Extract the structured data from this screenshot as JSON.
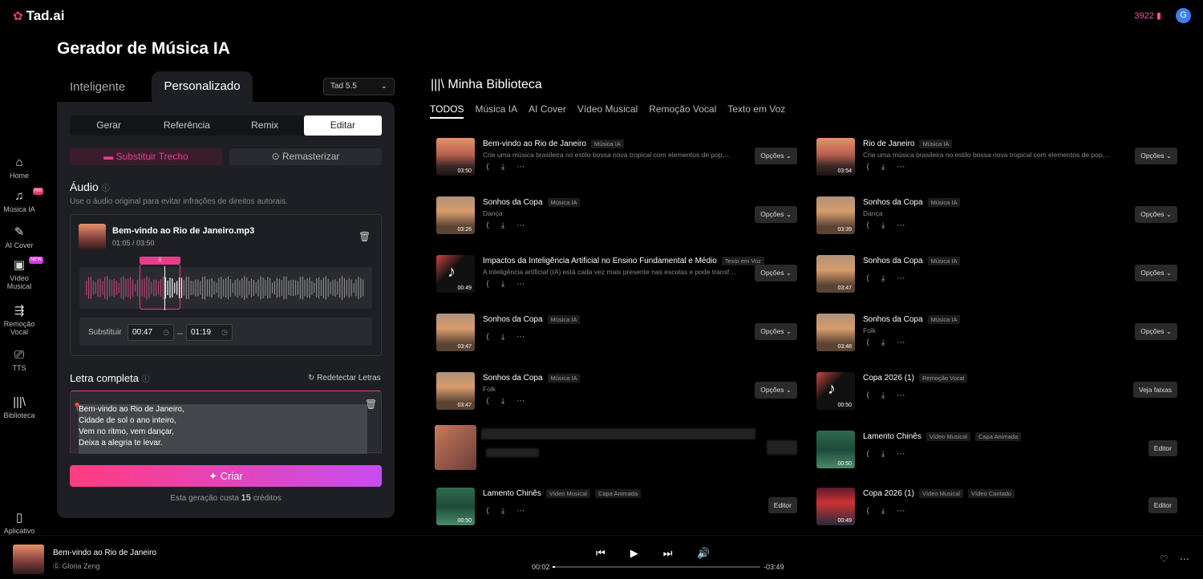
{
  "app": {
    "logo": "Tad.ai",
    "credits": "3922",
    "avatar": "G"
  },
  "sidebar": [
    {
      "label": "Home",
      "icon": "home-icon",
      "glyph": "⌂"
    },
    {
      "label": "Música IA",
      "icon": "music-icon",
      "glyph": "♫",
      "badge": "Hot"
    },
    {
      "label": "AI Cover",
      "icon": "mic-icon",
      "glyph": "✎"
    },
    {
      "label": "Vídeo Musical",
      "icon": "video-icon",
      "glyph": "▣",
      "badge": "NEW"
    },
    {
      "label": "Remoção Vocal",
      "icon": "split-icon",
      "glyph": "⇶"
    },
    {
      "label": "TTS",
      "icon": "tts-icon",
      "glyph": "⎚"
    },
    {
      "label": "Biblioteca",
      "icon": "library-icon",
      "glyph": "|||\\"
    },
    {
      "label": "Aplicativo",
      "icon": "phone-icon",
      "glyph": "▯"
    }
  ],
  "page_title": "Gerador de Música IA",
  "tabs": {
    "inteligente": "Inteligente",
    "personalizado": "Personalizado"
  },
  "model": "Tad 5.5",
  "subtabs": [
    "Gerar",
    "Referência",
    "Remix",
    "Editar"
  ],
  "modes": {
    "substituir": "Substituir Trecho",
    "remasterizar": "Remasterizar"
  },
  "audio": {
    "title": "Áudio",
    "note": "Use o áudio original para evitar infrações de direitos autorais.",
    "file": "Bem-vindo ao Rio de Janeiro.mp3",
    "time": "01:05 / 03:50",
    "sub_label": "Substituir",
    "start": "00:47",
    "end": "01:19"
  },
  "lyrics": {
    "title": "Letra completa",
    "redetect": "Redetectar Letras",
    "lines": [
      "Bem-vindo ao Rio de Janeiro,",
      "Cidade de sol o ano inteiro,",
      "Vem no ritmo, vem dançar,",
      "Deixa a alegria te levar."
    ]
  },
  "create": {
    "label": "Criar",
    "cost_pre": "Esta geração custa",
    "cost_num": "15",
    "cost_post": "créditos"
  },
  "library": {
    "title": "Minha Biblioteca",
    "tabs": [
      "TODOS",
      "Música IA",
      "AI Cover",
      "Vídeo Musical",
      "Remoção Vocal",
      "Texto em Voz"
    ],
    "left": [
      {
        "title": "Bem-vindo ao Rio de Janeiro",
        "tags": [
          "Música IA"
        ],
        "desc": "Crie uma música brasileira no estilo bossa nova tropical com elementos de pop,...",
        "dur": "03:50",
        "btn": "Opções ⌄",
        "thumb": "sunset"
      },
      {
        "title": "Sonhos da Copa",
        "tags": [
          "Música IA"
        ],
        "desc": "Dança",
        "dur": "03:26",
        "btn": "Opções ⌄",
        "thumb": "beach"
      },
      {
        "title": "Impactos da Inteligência Artificial no Ensino Fundamental e Médio",
        "tags": [
          "Texto em Voz"
        ],
        "desc": "A inteligência artificial (IA) está cada vez mais presente nas escolas e pode transformar a forma...",
        "dur": "00:49",
        "btn": "Opções ⌄",
        "thumb": "note"
      },
      {
        "title": "Sonhos da Copa",
        "tags": [
          "Música IA"
        ],
        "desc": "",
        "dur": "03:47",
        "btn": "Opções ⌄",
        "thumb": "beach"
      },
      {
        "title": "Sonhos da Copa",
        "tags": [
          "Música IA"
        ],
        "desc": "Folk",
        "dur": "03:47",
        "btn": "Opções ⌄",
        "thumb": "beach"
      },
      {
        "blurred": true
      },
      {
        "title": "Lamento Chinês",
        "tags": [
          "Vídeo Musical",
          "Capa Animada"
        ],
        "desc": "",
        "dur": "00:50",
        "btn": "Editor",
        "thumb": "forest"
      }
    ],
    "right": [
      {
        "title": "Rio de Janeiro",
        "tags": [
          "Música IA"
        ],
        "desc": "Crie uma música brasileira no estilo bossa nova tropical com elementos de pop,...",
        "dur": "03:54",
        "btn": "Opções ⌄",
        "thumb": "sunset"
      },
      {
        "title": "Sonhos da Copa",
        "tags": [
          "Música IA"
        ],
        "desc": "Dança",
        "dur": "03:39",
        "btn": "Opções ⌄",
        "thumb": "beach"
      },
      {
        "title": "Sonhos da Copa",
        "tags": [
          "Música IA"
        ],
        "desc": "",
        "dur": "03:47",
        "btn": "Opções ⌄",
        "thumb": "beach"
      },
      {
        "title": "Sonhos da Copa",
        "tags": [
          "Música IA"
        ],
        "desc": "Folk",
        "dur": "03:48",
        "btn": "Opções ⌄",
        "thumb": "beach"
      },
      {
        "title": "Copa 2026 (1)",
        "tags": [
          "Remoção Vocal"
        ],
        "desc": "",
        "dur": "00:50",
        "btn": "Veja faixas",
        "thumb": "note"
      },
      {
        "title": "Lamento Chinês",
        "tags": [
          "Vídeo Musical",
          "Capa Animada"
        ],
        "desc": "",
        "dur": "00:50",
        "btn": "Editor",
        "thumb": "forest"
      },
      {
        "title": "Copa 2026 (1)",
        "tags": [
          "Vídeo Musical",
          "Vídeo Cantado"
        ],
        "desc": "",
        "dur": "00:49",
        "btn": "Editor",
        "thumb": "stadium"
      }
    ]
  },
  "player": {
    "title": "Bem-vindo ao Rio de Janeiro",
    "artist": "Gloria Zeng",
    "current": "00:02",
    "remaining": "-03:49",
    "progress": 0.01
  }
}
